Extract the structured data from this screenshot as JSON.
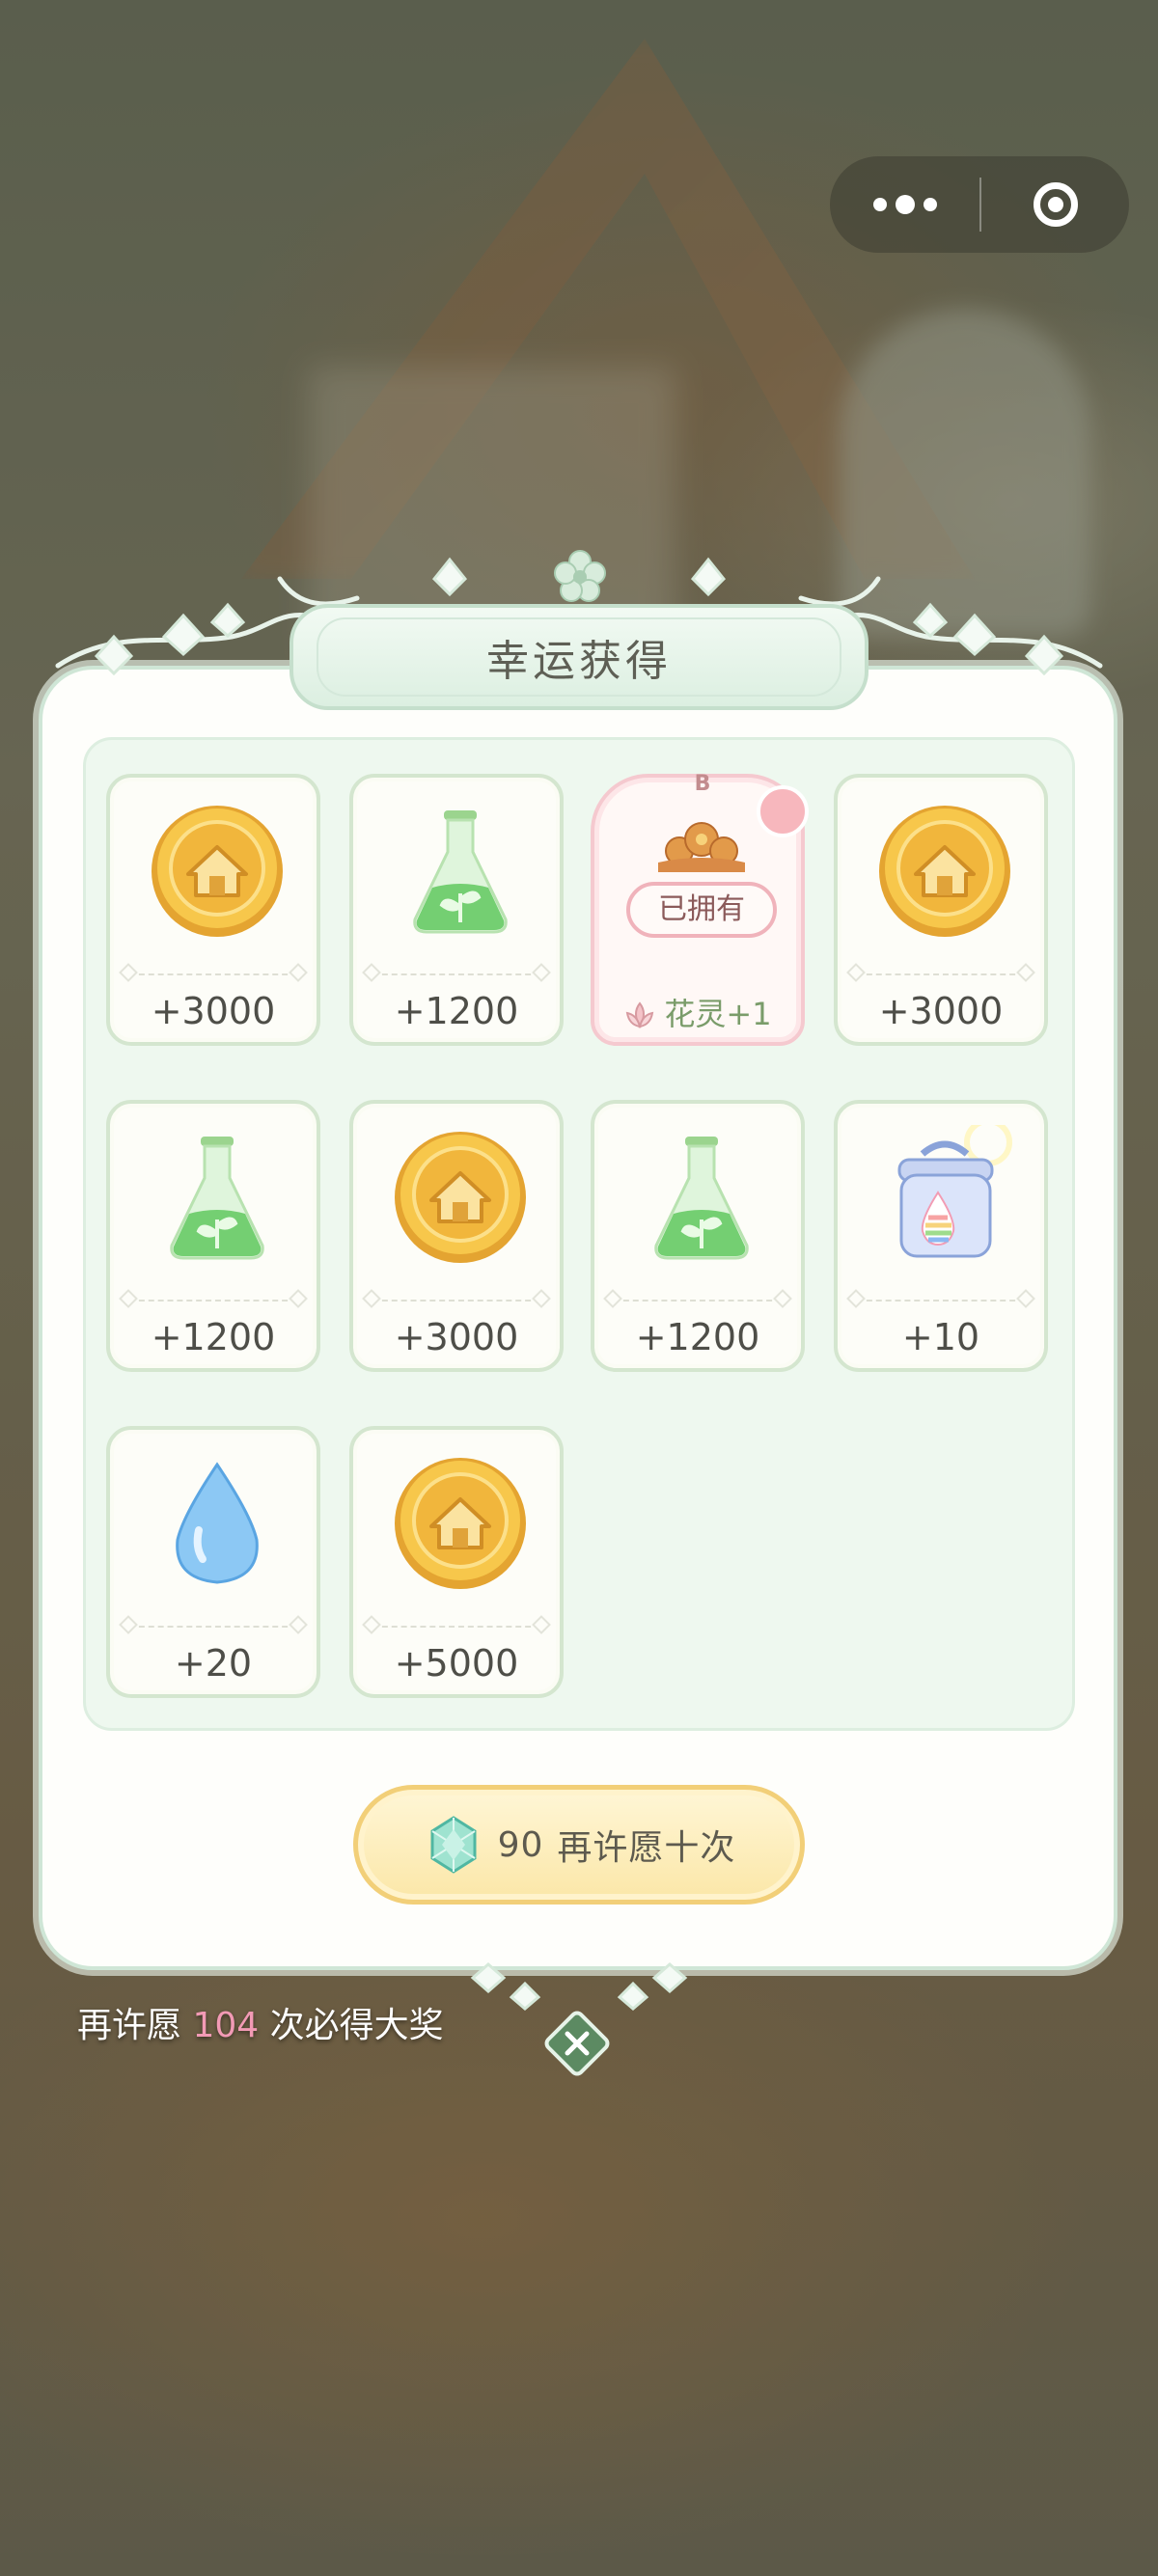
{
  "title": "幸运获得",
  "cards": [
    {
      "icon": "gold-coin-icon",
      "amount": "+3000"
    },
    {
      "icon": "green-potion-icon",
      "amount": "+1200"
    },
    {
      "icon": "flower-spirit-icon",
      "badge": "B",
      "status": "已拥有",
      "reward": "花灵+1"
    },
    {
      "icon": "gold-coin-icon",
      "amount": "+3000"
    },
    {
      "icon": "green-potion-icon",
      "amount": "+1200"
    },
    {
      "icon": "gold-coin-icon",
      "amount": "+3000"
    },
    {
      "icon": "green-potion-icon",
      "amount": "+1200"
    },
    {
      "icon": "rainbow-jar-icon",
      "amount": "+10"
    },
    {
      "icon": "water-drop-icon",
      "amount": "+20"
    },
    {
      "icon": "gold-coin-icon",
      "amount": "+5000"
    }
  ],
  "wish_button": {
    "cost": "90",
    "label": "再许愿十次"
  },
  "guarantee": {
    "prefix": "再许愿",
    "count": "104",
    "suffix": "次必得大奖"
  },
  "colors": {
    "panel_border": "#cfe6d6",
    "highlight_count": "#f29ab5",
    "button_border": "#f2cf78"
  }
}
